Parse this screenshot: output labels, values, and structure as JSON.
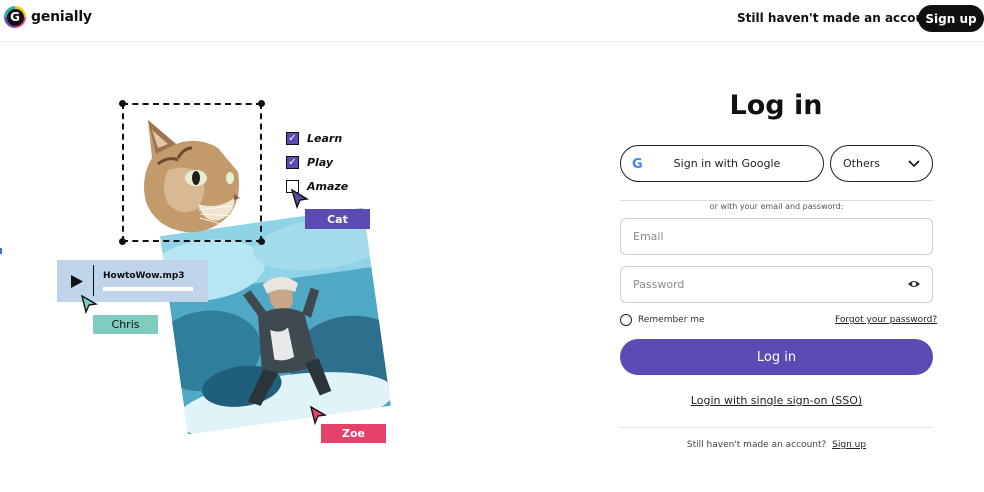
{
  "header": {
    "brand": "genially",
    "prompt": "Still haven't made an account?",
    "signup_label": "Sign up"
  },
  "illustration": {
    "checklist": [
      {
        "label": "Learn",
        "checked": true
      },
      {
        "label": "Play",
        "checked": true
      },
      {
        "label": "Amaze",
        "checked": false
      }
    ],
    "tags": {
      "cat": "Cat",
      "chris": "Chris",
      "zoe": "Zoe"
    },
    "audio_file": "HowtoWow.mp3",
    "colors": {
      "purple": "#5b4bb5",
      "teal": "#7fcbbf",
      "pink": "#e8406a",
      "audio_bg": "#bfd3ea"
    }
  },
  "login": {
    "title": "Log in",
    "google_label": "Sign in with Google",
    "others_label": "Others",
    "divider_text": "or with your email and password:",
    "email_placeholder": "Email",
    "password_placeholder": "Password",
    "remember_label": "Remember me",
    "forgot_label": "Forgot your password?",
    "login_button": "Log in",
    "sso_label": "Login with single sign-on (SSO)",
    "bottom_prompt": "Still haven't made an account?",
    "bottom_signup": "Sign up",
    "accent": "#5b4bb5"
  }
}
